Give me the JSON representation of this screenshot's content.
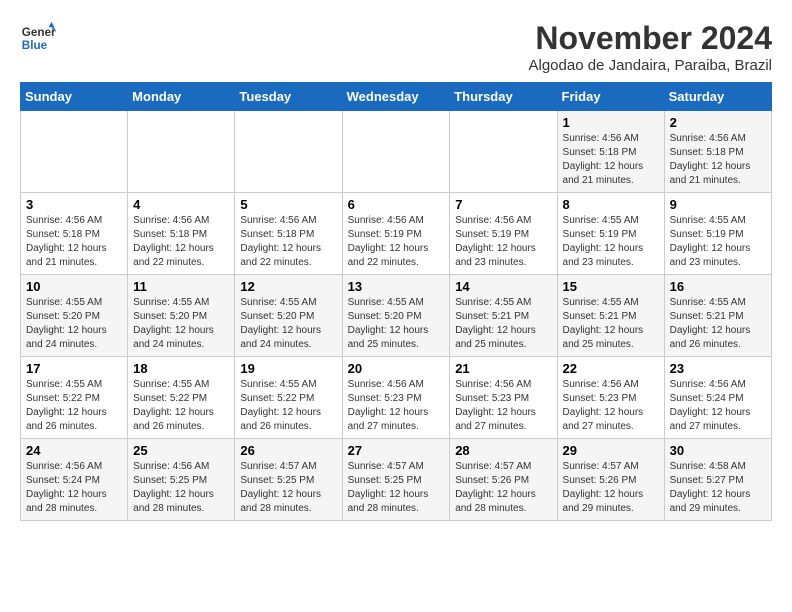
{
  "logo": {
    "line1": "General",
    "line2": "Blue"
  },
  "header": {
    "month": "November 2024",
    "location": "Algodao de Jandaira, Paraiba, Brazil"
  },
  "weekdays": [
    "Sunday",
    "Monday",
    "Tuesday",
    "Wednesday",
    "Thursday",
    "Friday",
    "Saturday"
  ],
  "weeks": [
    [
      {
        "day": "",
        "info": ""
      },
      {
        "day": "",
        "info": ""
      },
      {
        "day": "",
        "info": ""
      },
      {
        "day": "",
        "info": ""
      },
      {
        "day": "",
        "info": ""
      },
      {
        "day": "1",
        "info": "Sunrise: 4:56 AM\nSunset: 5:18 PM\nDaylight: 12 hours and 21 minutes."
      },
      {
        "day": "2",
        "info": "Sunrise: 4:56 AM\nSunset: 5:18 PM\nDaylight: 12 hours and 21 minutes."
      }
    ],
    [
      {
        "day": "3",
        "info": "Sunrise: 4:56 AM\nSunset: 5:18 PM\nDaylight: 12 hours and 21 minutes."
      },
      {
        "day": "4",
        "info": "Sunrise: 4:56 AM\nSunset: 5:18 PM\nDaylight: 12 hours and 22 minutes."
      },
      {
        "day": "5",
        "info": "Sunrise: 4:56 AM\nSunset: 5:18 PM\nDaylight: 12 hours and 22 minutes."
      },
      {
        "day": "6",
        "info": "Sunrise: 4:56 AM\nSunset: 5:19 PM\nDaylight: 12 hours and 22 minutes."
      },
      {
        "day": "7",
        "info": "Sunrise: 4:56 AM\nSunset: 5:19 PM\nDaylight: 12 hours and 23 minutes."
      },
      {
        "day": "8",
        "info": "Sunrise: 4:55 AM\nSunset: 5:19 PM\nDaylight: 12 hours and 23 minutes."
      },
      {
        "day": "9",
        "info": "Sunrise: 4:55 AM\nSunset: 5:19 PM\nDaylight: 12 hours and 23 minutes."
      }
    ],
    [
      {
        "day": "10",
        "info": "Sunrise: 4:55 AM\nSunset: 5:20 PM\nDaylight: 12 hours and 24 minutes."
      },
      {
        "day": "11",
        "info": "Sunrise: 4:55 AM\nSunset: 5:20 PM\nDaylight: 12 hours and 24 minutes."
      },
      {
        "day": "12",
        "info": "Sunrise: 4:55 AM\nSunset: 5:20 PM\nDaylight: 12 hours and 24 minutes."
      },
      {
        "day": "13",
        "info": "Sunrise: 4:55 AM\nSunset: 5:20 PM\nDaylight: 12 hours and 25 minutes."
      },
      {
        "day": "14",
        "info": "Sunrise: 4:55 AM\nSunset: 5:21 PM\nDaylight: 12 hours and 25 minutes."
      },
      {
        "day": "15",
        "info": "Sunrise: 4:55 AM\nSunset: 5:21 PM\nDaylight: 12 hours and 25 minutes."
      },
      {
        "day": "16",
        "info": "Sunrise: 4:55 AM\nSunset: 5:21 PM\nDaylight: 12 hours and 26 minutes."
      }
    ],
    [
      {
        "day": "17",
        "info": "Sunrise: 4:55 AM\nSunset: 5:22 PM\nDaylight: 12 hours and 26 minutes."
      },
      {
        "day": "18",
        "info": "Sunrise: 4:55 AM\nSunset: 5:22 PM\nDaylight: 12 hours and 26 minutes."
      },
      {
        "day": "19",
        "info": "Sunrise: 4:55 AM\nSunset: 5:22 PM\nDaylight: 12 hours and 26 minutes."
      },
      {
        "day": "20",
        "info": "Sunrise: 4:56 AM\nSunset: 5:23 PM\nDaylight: 12 hours and 27 minutes."
      },
      {
        "day": "21",
        "info": "Sunrise: 4:56 AM\nSunset: 5:23 PM\nDaylight: 12 hours and 27 minutes."
      },
      {
        "day": "22",
        "info": "Sunrise: 4:56 AM\nSunset: 5:23 PM\nDaylight: 12 hours and 27 minutes."
      },
      {
        "day": "23",
        "info": "Sunrise: 4:56 AM\nSunset: 5:24 PM\nDaylight: 12 hours and 27 minutes."
      }
    ],
    [
      {
        "day": "24",
        "info": "Sunrise: 4:56 AM\nSunset: 5:24 PM\nDaylight: 12 hours and 28 minutes."
      },
      {
        "day": "25",
        "info": "Sunrise: 4:56 AM\nSunset: 5:25 PM\nDaylight: 12 hours and 28 minutes."
      },
      {
        "day": "26",
        "info": "Sunrise: 4:57 AM\nSunset: 5:25 PM\nDaylight: 12 hours and 28 minutes."
      },
      {
        "day": "27",
        "info": "Sunrise: 4:57 AM\nSunset: 5:25 PM\nDaylight: 12 hours and 28 minutes."
      },
      {
        "day": "28",
        "info": "Sunrise: 4:57 AM\nSunset: 5:26 PM\nDaylight: 12 hours and 28 minutes."
      },
      {
        "day": "29",
        "info": "Sunrise: 4:57 AM\nSunset: 5:26 PM\nDaylight: 12 hours and 29 minutes."
      },
      {
        "day": "30",
        "info": "Sunrise: 4:58 AM\nSunset: 5:27 PM\nDaylight: 12 hours and 29 minutes."
      }
    ]
  ]
}
